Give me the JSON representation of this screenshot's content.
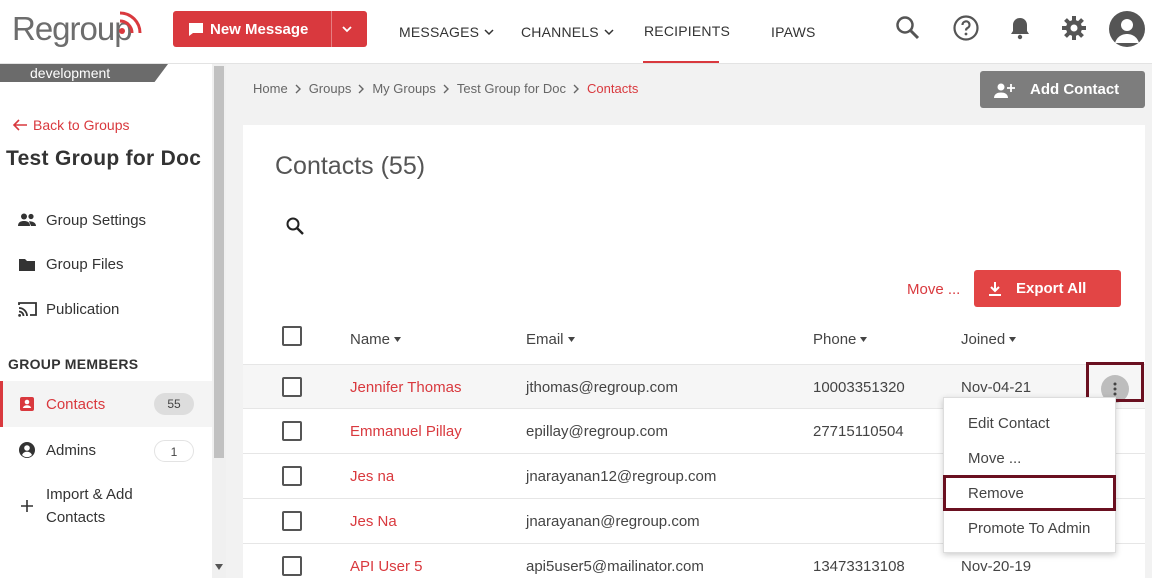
{
  "brand": {
    "logo_text": "Regroup",
    "accent": "#d9393e"
  },
  "toolbar": {
    "new_message_label": "New Message",
    "nav": [
      {
        "label": "MESSAGES"
      },
      {
        "label": "CHANNELS"
      },
      {
        "label": "RECIPIENTS"
      },
      {
        "label": "IPAWS"
      }
    ],
    "active_nav": "RECIPIENTS",
    "icons": [
      "search-icon",
      "help-icon",
      "bell-icon",
      "gear-icon",
      "avatar-icon"
    ]
  },
  "sidebar": {
    "environment": "development",
    "back_label": "Back to Groups",
    "group_title": "Test Group for Doc",
    "items": [
      {
        "label": "Group Settings",
        "icon": "people-icon"
      },
      {
        "label": "Group Files",
        "icon": "folder-icon"
      },
      {
        "label": "Publication",
        "icon": "cast-icon"
      }
    ],
    "section_label": "GROUP MEMBERS",
    "members": [
      {
        "label": "Contacts",
        "count": "55",
        "icon": "contact-card-icon",
        "active": true
      },
      {
        "label": "Admins",
        "count": "1",
        "icon": "account-circle-icon"
      },
      {
        "label": "Import & Add",
        "label2": "Contacts",
        "icon": "plus-icon"
      }
    ]
  },
  "main": {
    "breadcrumb": [
      "Home",
      "Groups",
      "My Groups",
      "Test Group for Doc",
      "Contacts"
    ],
    "add_contact_label": "Add Contact",
    "title": "Contacts (55)",
    "move_label": "Move ...",
    "export_label": "Export All",
    "columns": {
      "name": "Name",
      "email": "Email",
      "phone": "Phone",
      "joined": "Joined"
    },
    "rows": [
      {
        "name": "Jennifer Thomas",
        "email": "jthomas@regroup.com",
        "phone": "10003351320",
        "joined": "Nov-04-21"
      },
      {
        "name": "Emmanuel Pillay",
        "email": "epillay@regroup.com",
        "phone": "27715110504",
        "joined": ""
      },
      {
        "name": "Jes na",
        "email": "jnarayanan12@regroup.com",
        "phone": "",
        "joined": ""
      },
      {
        "name": "Jes Na",
        "email": "jnarayanan@regroup.com",
        "phone": "",
        "joined": ""
      },
      {
        "name": "API User 5",
        "email": "api5user5@mailinator.com",
        "phone": "13473313108",
        "joined": "Nov-20-19"
      }
    ],
    "context_menu": [
      "Edit Contact",
      "Move ...",
      "Remove",
      "Promote To Admin"
    ]
  }
}
